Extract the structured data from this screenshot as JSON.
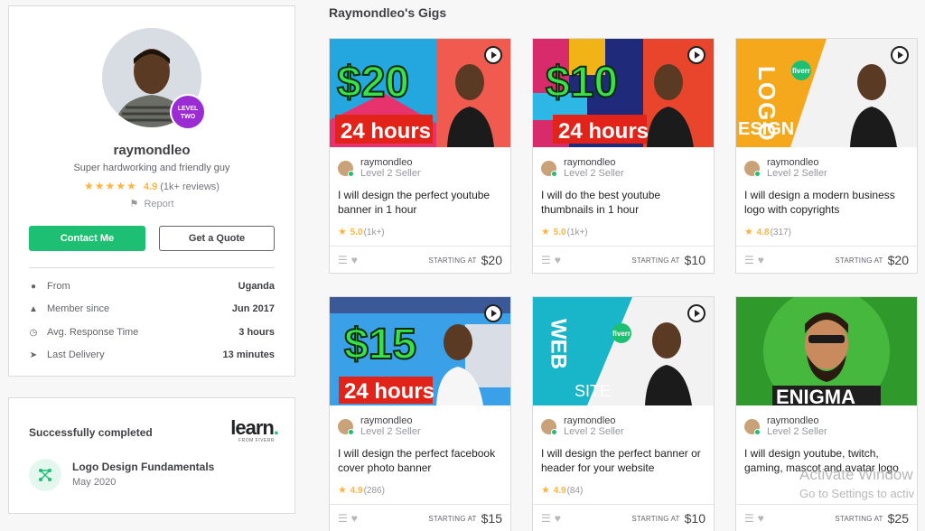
{
  "profile": {
    "username": "raymondleo",
    "level_badge_line1": "LEVEL",
    "level_badge_line2": "TWO",
    "tagline": "Super hardworking and friendly guy",
    "rating": "4.9",
    "reviews": "(1k+ reviews)",
    "report": "Report",
    "contact_button": "Contact Me",
    "quote_button": "Get a Quote",
    "stats": [
      {
        "icon": "location-pin-icon",
        "label": "From",
        "value": "Uganda"
      },
      {
        "icon": "user-icon",
        "label": "Member since",
        "value": "Jun 2017"
      },
      {
        "icon": "clock-icon",
        "label": "Avg. Response Time",
        "value": "3 hours"
      },
      {
        "icon": "paper-plane-icon",
        "label": "Last Delivery",
        "value": "13 minutes"
      }
    ]
  },
  "learn": {
    "title": "Successfully completed",
    "logo_word": "learn",
    "logo_dot": ".",
    "logo_sub": "FROM FIVERR",
    "course_name": "Logo Design Fundamentals",
    "course_date": "May 2020"
  },
  "gigs_title": "Raymondleo's Gigs",
  "gigs": [
    {
      "seller": "raymondleo",
      "level": "Level 2 Seller",
      "title": "I will design the perfect youtube banner in 1 hour",
      "rating": "5.0",
      "count": "(1k+)",
      "starting": "STARTING AT",
      "price": "$20",
      "thumb_big": "$20",
      "thumb_small": "24 hours"
    },
    {
      "seller": "raymondleo",
      "level": "Level 2 Seller",
      "title": "I will do the best youtube thumbnails in 1 hour",
      "rating": "5.0",
      "count": "(1k+)",
      "starting": "STARTING AT",
      "price": "$10",
      "thumb_big": "$10",
      "thumb_small": "24 hours"
    },
    {
      "seller": "raymondleo",
      "level": "Level 2 Seller",
      "title": "I will design a modern business logo with copyrights",
      "rating": "4.8",
      "count": "(317)",
      "starting": "STARTING AT",
      "price": "$20",
      "thumb_big": "LOGO",
      "thumb_small": "ESIGN",
      "thumb_tag": "fiverr"
    },
    {
      "seller": "raymondleo",
      "level": "Level 2 Seller",
      "title": "I will design the perfect facebook cover photo banner",
      "rating": "4.9",
      "count": "(286)",
      "starting": "STARTING AT",
      "price": "$15",
      "thumb_big": "$15",
      "thumb_small": "24 hours"
    },
    {
      "seller": "raymondleo",
      "level": "Level 2 Seller",
      "title": "I will design the perfect banner or header for your website",
      "rating": "4.9",
      "count": "(84)",
      "starting": "STARTING AT",
      "price": "$10",
      "thumb_big": "WEB",
      "thumb_small": "SITE",
      "thumb_tag": "fiverr"
    },
    {
      "seller": "raymondleo",
      "level": "Level 2 Seller",
      "title": "I will design youtube, twitch, gaming, mascot and avatar logo",
      "rating": "",
      "count": "",
      "starting": "STARTING AT",
      "price": "$25",
      "thumb_big": "ENIGMA",
      "thumb_small": ""
    }
  ],
  "watermark": {
    "line1": "Activate Window",
    "line2": "Go to Settings to activ"
  },
  "colors": {
    "accent": "#1dbf73",
    "star": "#ffb33e",
    "level_badge": "#9b2bd3"
  }
}
